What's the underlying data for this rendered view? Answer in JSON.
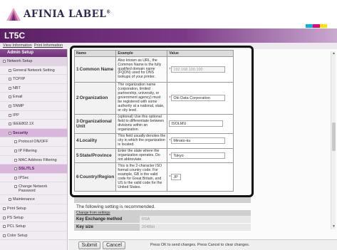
{
  "brand": {
    "name": "AFINIA LABEL",
    "reg": "®"
  },
  "colors": {
    "brand_purple": "#6e2f78",
    "highlight": "#111111"
  },
  "app": {
    "title": "LT5C"
  },
  "infobar": {
    "links": [
      "View Information",
      "Print Information"
    ]
  },
  "sidebar": {
    "header": "Admin Setup",
    "items": [
      {
        "label": "Network Setup",
        "level": 0,
        "box": true,
        "state": "net"
      },
      {
        "label": "General Network Setting",
        "level": 1,
        "box": true
      },
      {
        "label": "TCP/IP",
        "level": 1,
        "box": true
      },
      {
        "label": "NBT",
        "level": 1,
        "box": true
      },
      {
        "label": "Email",
        "level": 1,
        "box": true
      },
      {
        "label": "SNMP",
        "level": 1,
        "box": true
      },
      {
        "label": "IPP",
        "level": 1,
        "box": true
      },
      {
        "label": "IEEE802.1X",
        "level": 1,
        "box": true
      },
      {
        "label": "Security",
        "level": 1,
        "box": true,
        "state": "active"
      },
      {
        "label": "Protocol ON/OFF",
        "level": 2,
        "box": true
      },
      {
        "label": "IP Filtering",
        "level": 2,
        "box": true
      },
      {
        "label": "MAC Address Filtering",
        "level": 2,
        "box": true
      },
      {
        "label": "SSL/TLS",
        "level": 2,
        "box": true,
        "state": "active"
      },
      {
        "label": "IPSec",
        "level": 2,
        "box": true
      },
      {
        "label": "Change Network",
        "label2": "Password",
        "level": 2,
        "box": true
      },
      {
        "label": "Maintenance",
        "level": 1,
        "box": true
      },
      {
        "label": "Print Setup",
        "level": 0,
        "box": true
      },
      {
        "label": "PS Setup",
        "level": 0,
        "box": true
      },
      {
        "label": "PCL Setup",
        "level": 0,
        "box": true
      },
      {
        "label": "Color Setup",
        "level": 0,
        "box": true
      }
    ]
  },
  "table": {
    "headers": [
      "Name",
      "Example",
      "Value"
    ],
    "rows": [
      {
        "num": "1",
        "name": "Common Name",
        "example": "Also known as URL, the Common Name is the fully qualified domain name (FQDN) used for DNS lookups of your printer.",
        "value": "192.168.100.100",
        "required": true,
        "disabled": true
      },
      {
        "num": "2",
        "name": "Organization",
        "example": "The organization name (corporation, limited partnership, university, or government agency) must be registered with some authority at a national, state, or city level.",
        "value": "Oki Data Corporation",
        "required": true,
        "disabled": false
      },
      {
        "num": "3",
        "name": "Organizational Unit",
        "example": "(optional) Use this optional field to differentiate between divisions within an organization.",
        "value": "ISOLMU",
        "required": false,
        "disabled": false
      },
      {
        "num": "4",
        "name": "Locality",
        "example": "This field usually denotes the city in which the organization is located.",
        "value": "Minato-ku",
        "required": true,
        "disabled": false
      },
      {
        "num": "5",
        "name": "State/Province",
        "example": "Enter the state where the organization operates. Do not abbreviate.",
        "value": "Tokyo",
        "required": true,
        "disabled": false
      },
      {
        "num": "6",
        "name": "Country/Region",
        "example": "This is the 2-character ISO format country code. For example, GB is the valid code for Great Britain, and US is the valid code for the United States.",
        "value": "JP",
        "required": true,
        "disabled": false
      }
    ]
  },
  "lower": {
    "recommend": "The following setting is recommended.",
    "sub_link": "Change from settings",
    "fields": [
      {
        "key": "Key Exchange method",
        "value": "RSA"
      },
      {
        "key": "Key size",
        "value": "2048bit"
      }
    ]
  },
  "footer": {
    "submit": "Submit",
    "cancel": "Cancel",
    "note": "Press OK to send changes. Press Cancel to clear changes."
  }
}
